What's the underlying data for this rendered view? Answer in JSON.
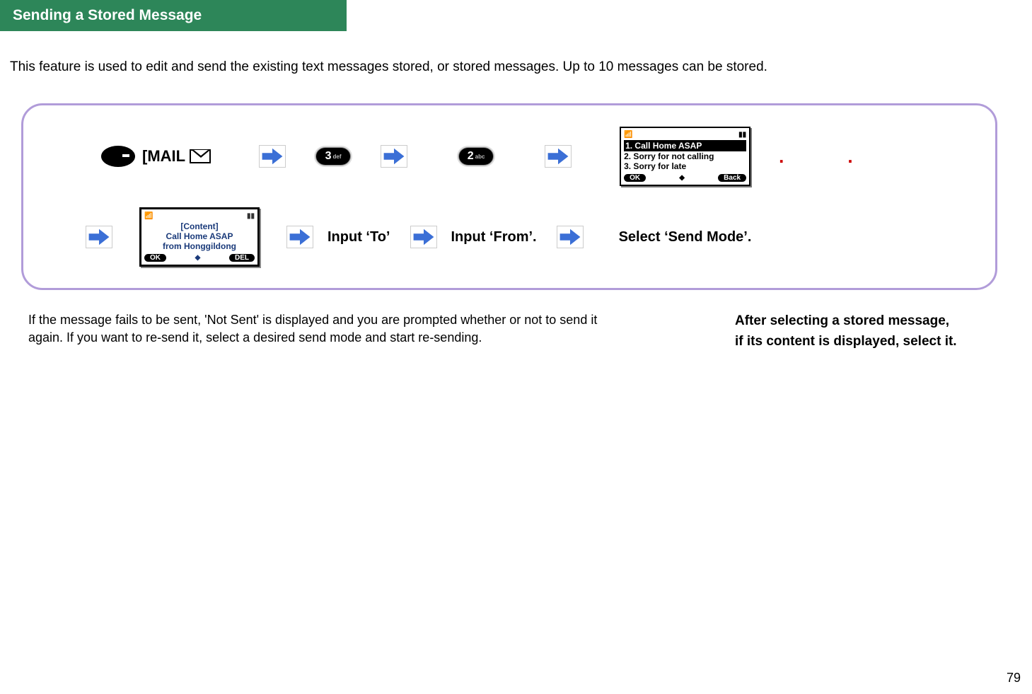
{
  "header": {
    "title": "Sending a Stored Message"
  },
  "intro": "This feature is used to edit and send the existing text messages stored, or stored messages. Up to 10 messages can be stored.",
  "flow": {
    "mail_label": "[MAIL",
    "key3": {
      "digit": "3",
      "sub": "def"
    },
    "key2": {
      "digit": "2",
      "sub": "abc"
    },
    "list_screen": {
      "items": [
        "1. Call Home ASAP",
        "2. Sorry for not calling",
        "3. Sorry for late"
      ],
      "sk_left": "OK",
      "sk_right": "Back"
    },
    "content_screen": {
      "title": "[Content]",
      "line1": "Call Home ASAP",
      "line2": "from Honggildong",
      "sk_left": "OK",
      "sk_right": "DEL"
    },
    "step_to": "Input ‘To’",
    "step_from": "Input ‘From’.",
    "step_mode": "Select ‘Send Mode’."
  },
  "footnote_left": "If the message fails to be sent, 'Not Sent' is displayed and you are prompted whether or not to send it again. If you want to re-send it, select a desired send mode and start re-sending.",
  "footnote_right_l1": "After selecting a stored message,",
  "footnote_right_l2": "if its content is displayed, select it.",
  "page_number": "79"
}
